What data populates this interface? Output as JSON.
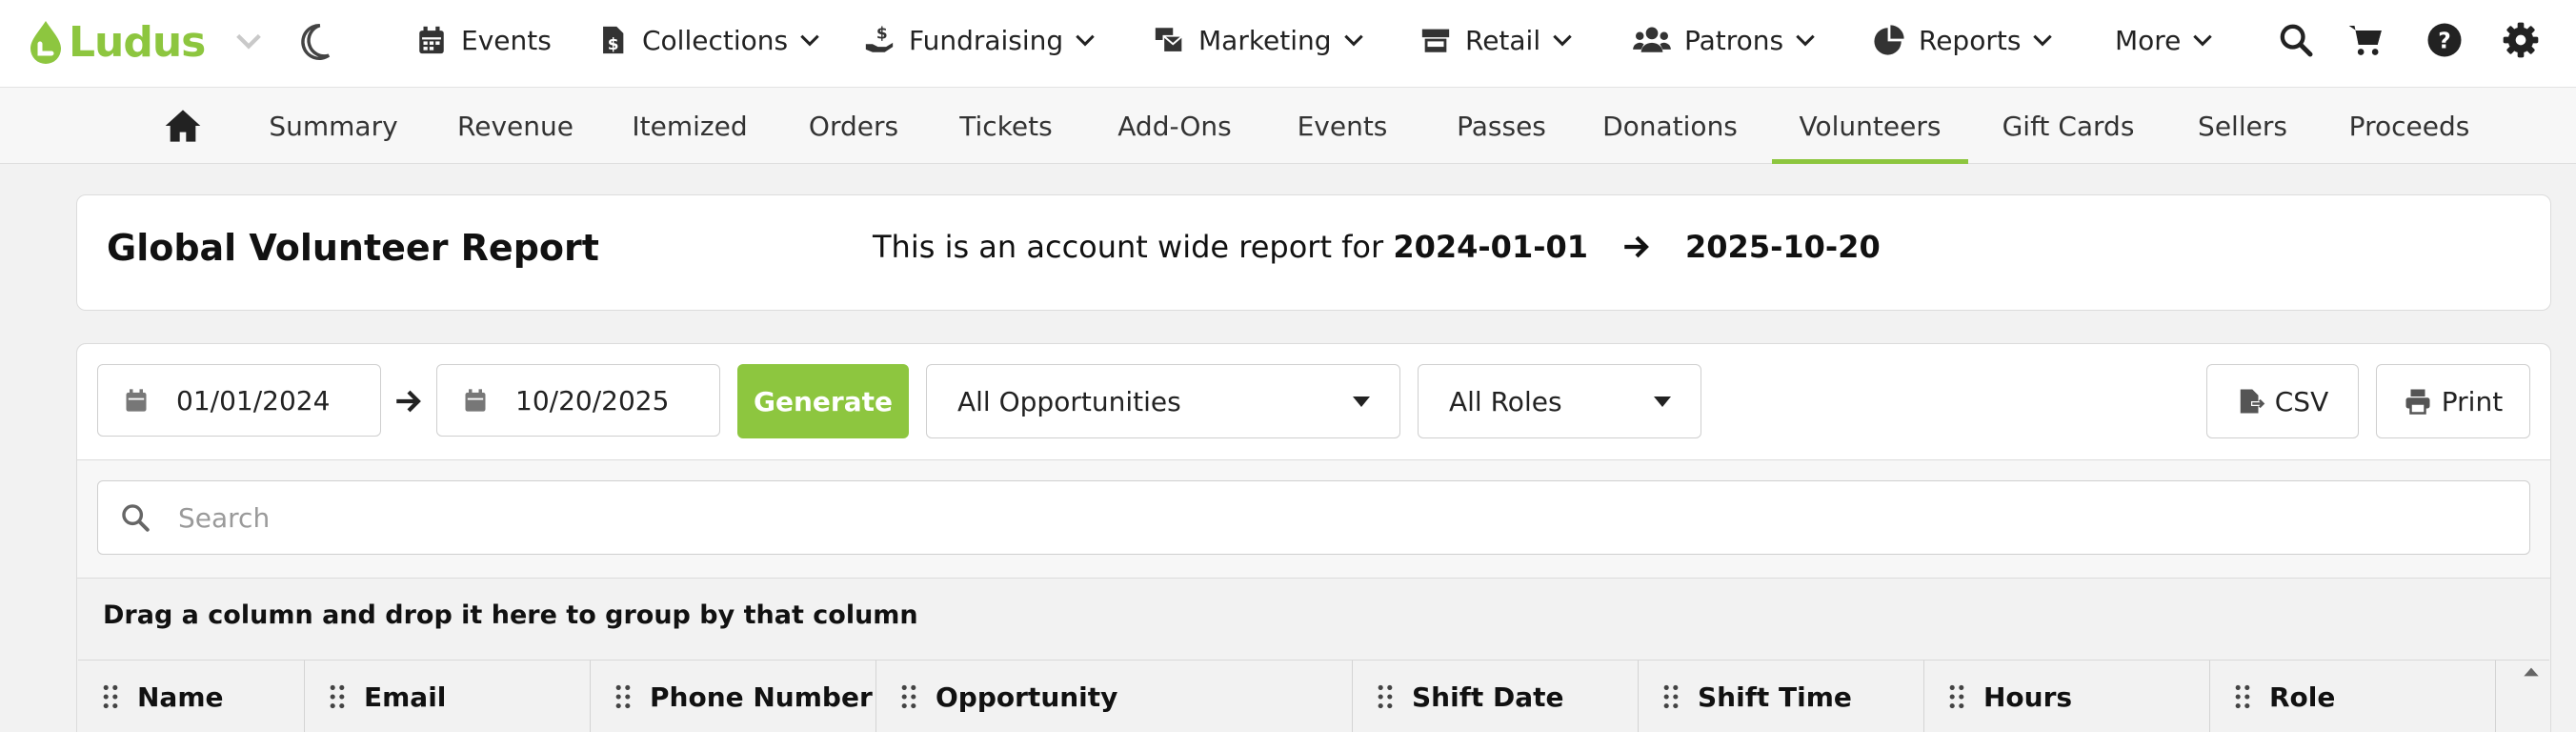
{
  "brand": {
    "name": "Ludus"
  },
  "nav": [
    {
      "label": "Events",
      "icon": "calendar-icon",
      "has_menu": false
    },
    {
      "label": "Collections",
      "icon": "dollar-file-icon",
      "has_menu": true
    },
    {
      "label": "Fundraising",
      "icon": "hand-holding-dollar-icon",
      "has_menu": true
    },
    {
      "label": "Marketing",
      "icon": "mail-bulk-icon",
      "has_menu": true
    },
    {
      "label": "Retail",
      "icon": "store-icon",
      "has_menu": true
    },
    {
      "label": "Patrons",
      "icon": "users-icon",
      "has_menu": true
    },
    {
      "label": "Reports",
      "icon": "pie-chart-icon",
      "has_menu": true
    },
    {
      "label": "More",
      "icon": "",
      "has_menu": true
    }
  ],
  "utility_icons": [
    "search-icon",
    "cart-icon",
    "help-icon",
    "gear-icon"
  ],
  "subnav": {
    "tabs": [
      "Summary",
      "Revenue",
      "Itemized",
      "Orders",
      "Tickets",
      "Add-Ons",
      "Events",
      "Passes",
      "Donations",
      "Volunteers",
      "Gift Cards",
      "Sellers",
      "Proceeds"
    ],
    "active": "Volunteers"
  },
  "report": {
    "title": "Global Volunteer Report",
    "description_prefix": "This is an account wide report for",
    "start_date": "2024-01-01",
    "end_date": "2025-10-20"
  },
  "controls": {
    "from_date": "01/01/2024",
    "to_date": "10/20/2025",
    "generate_label": "Generate",
    "opportunity_select": "All Opportunities",
    "role_select": "All Roles",
    "csv_label": "CSV",
    "print_label": "Print"
  },
  "search": {
    "placeholder": "Search"
  },
  "grid": {
    "group_hint": "Drag a column and drop it here to group by that column",
    "columns": [
      "Name",
      "Email",
      "Phone Number",
      "Opportunity",
      "Shift Date",
      "Shift Time",
      "Hours",
      "Role"
    ]
  },
  "colors": {
    "accent": "#8dc63f",
    "background": "#f2f2f2"
  }
}
